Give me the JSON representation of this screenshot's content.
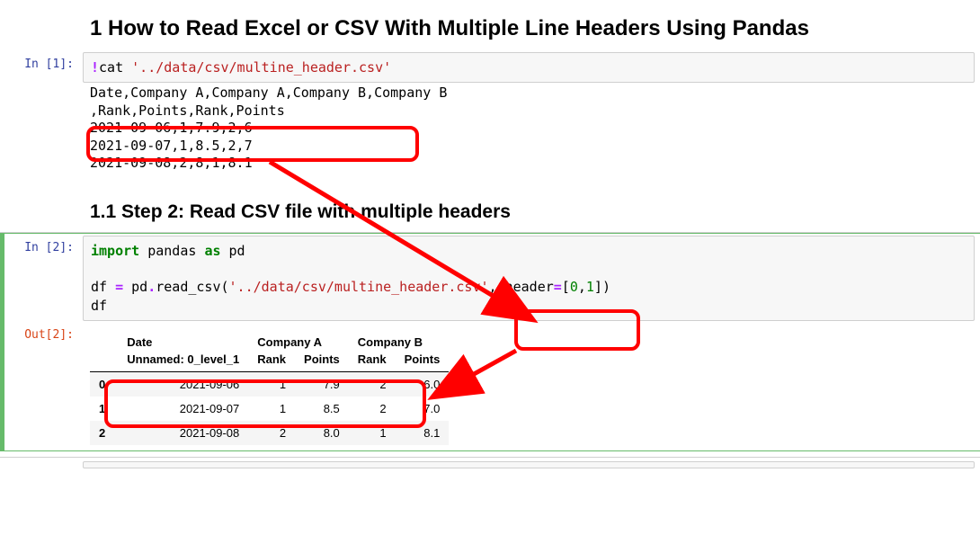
{
  "heading1": "1  How to Read Excel or CSV With Multiple Line Headers Using Pandas",
  "heading2": "1.1  Step 2: Read CSV file with multiple headers",
  "prompt_in1": "In [1]:",
  "prompt_in2": "In [2]:",
  "prompt_out2": "Out[2]:",
  "cell1": {
    "op": "!",
    "cmd": "cat ",
    "arg": "'../data/csv/multine_header.csv'"
  },
  "out1": {
    "l1": "Date,Company A,Company A,Company B,Company B",
    "l2": ",Rank,Points,Rank,Points",
    "l3": "2021-09-06,1,7.9,2,6",
    "l4": "2021-09-07,1,8.5,2,7",
    "l5": "2021-09-08,2,8,1,8.1"
  },
  "cell2": {
    "kw_import": "import",
    "mod": " pandas ",
    "kw_as": "as",
    "alias": " pd",
    "l2a": "df ",
    "op_eq": "=",
    "l2b": " pd",
    "op_dot1": ".",
    "l2c": "read_csv(",
    "str_path": "'../data/csv/multine_header.csv'",
    "l2d": ", header",
    "op_eq2": "=",
    "l2e": "[",
    "num0": "0",
    "l2f": ",",
    "num1": "1",
    "l2g": "])",
    "l3": "df"
  },
  "table": {
    "h_top": [
      "",
      "Date",
      "Company A",
      "Company A",
      "Company B",
      "Company B"
    ],
    "h_bot": [
      "",
      "Unnamed: 0_level_1",
      "Rank",
      "Points",
      "Rank",
      "Points"
    ],
    "rows": [
      {
        "idx": "0",
        "c": [
          "2021-09-06",
          "1",
          "7.9",
          "2",
          "6.0"
        ]
      },
      {
        "idx": "1",
        "c": [
          "2021-09-07",
          "1",
          "8.5",
          "2",
          "7.0"
        ]
      },
      {
        "idx": "2",
        "c": [
          "2021-09-08",
          "2",
          "8.0",
          "1",
          "8.1"
        ]
      }
    ]
  }
}
